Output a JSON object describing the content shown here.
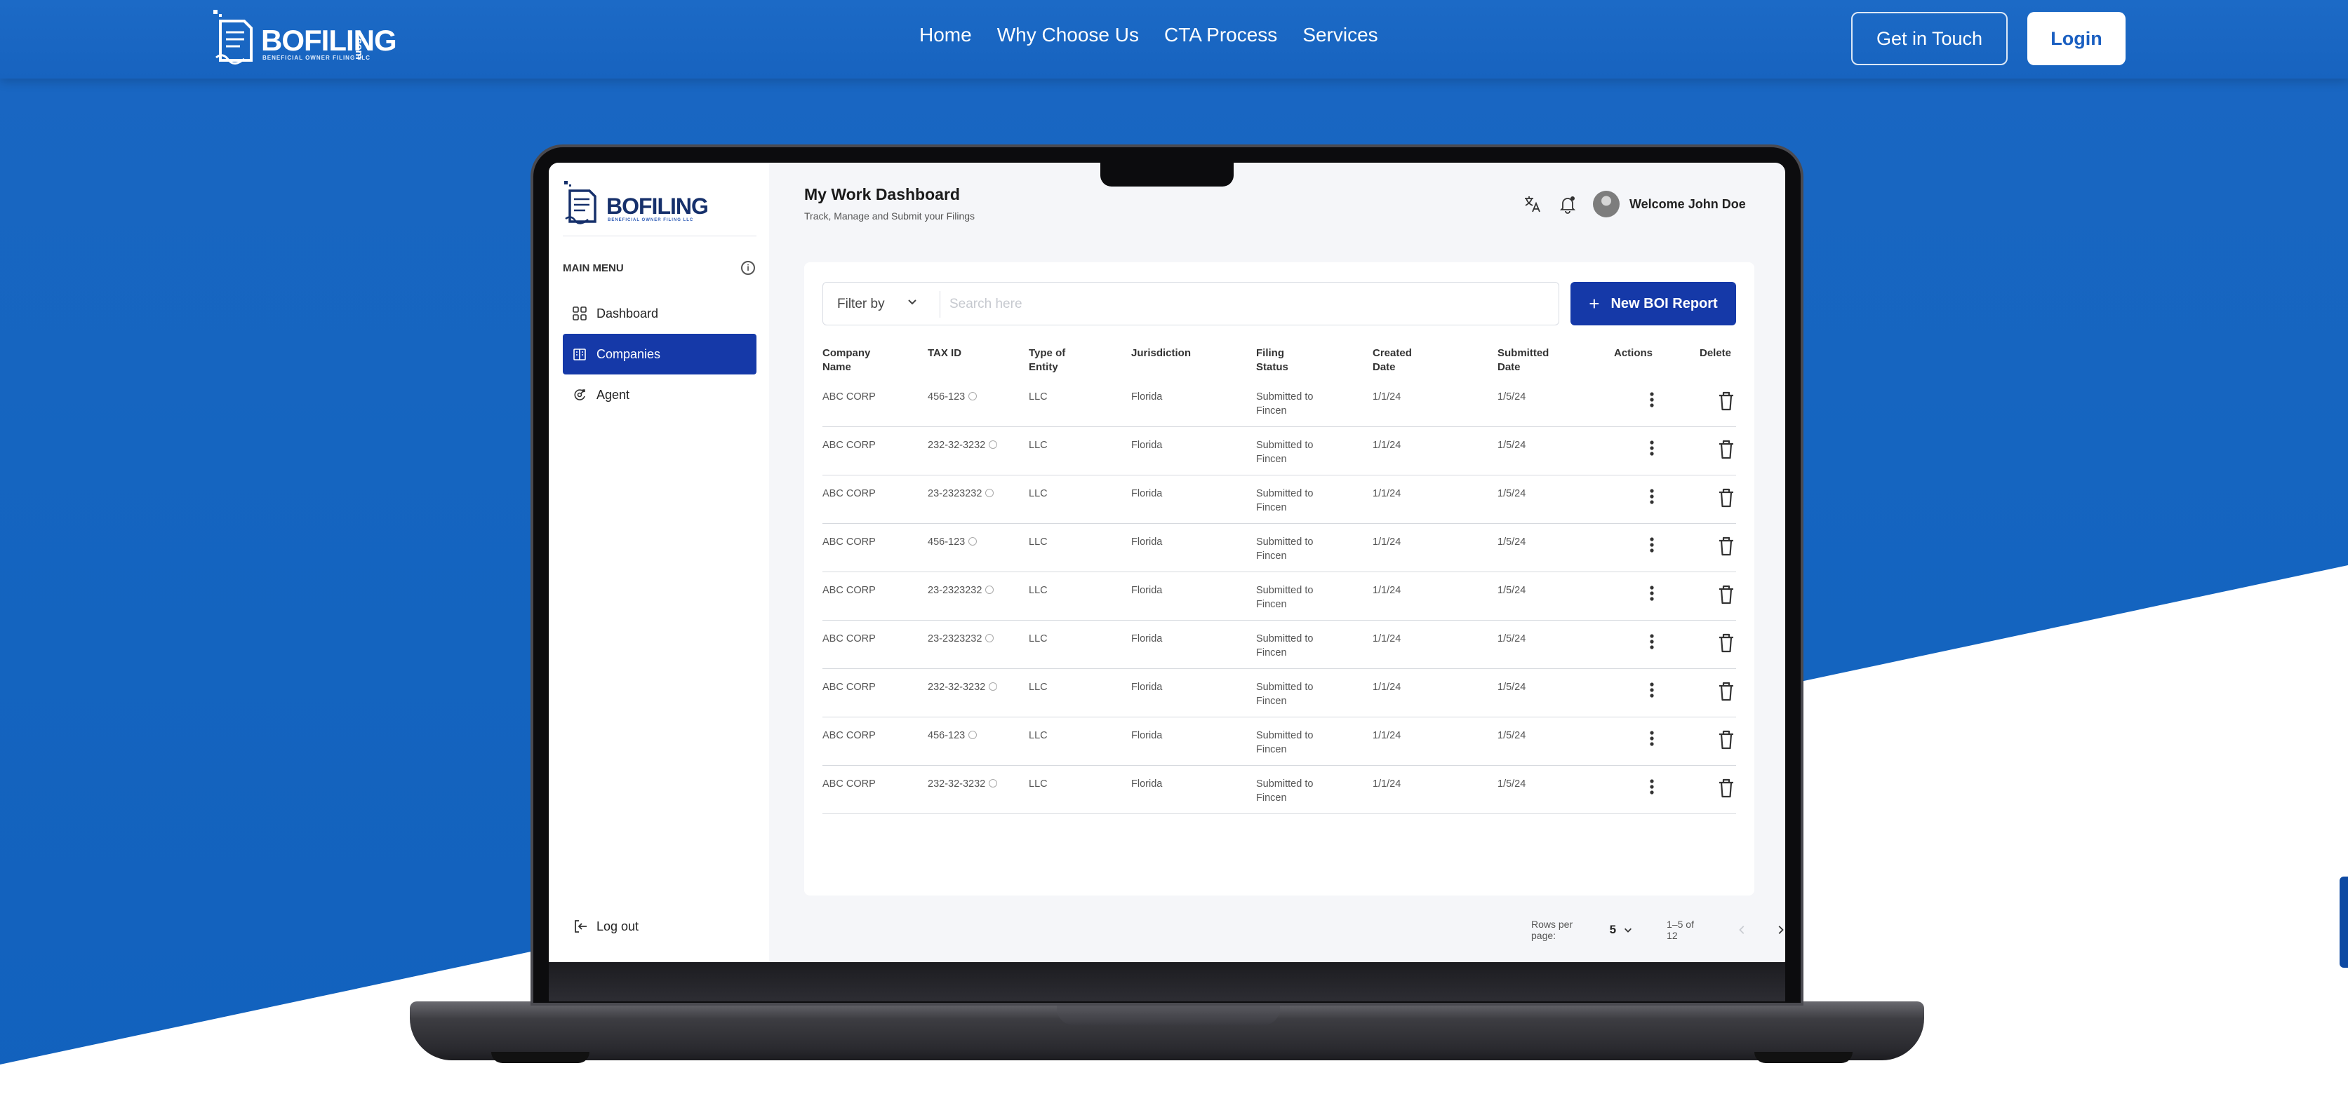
{
  "site": {
    "logo": {
      "text": "BOFILING",
      "sub": "BENEFICIAL OWNER FILING LLC",
      "com": ".com"
    },
    "nav": [
      "Home",
      "Why Choose Us",
      "CTA Process",
      "Services"
    ],
    "get_in_touch": "Get in Touch",
    "login": "Login",
    "colors": {
      "brand_blue": "#1565c0",
      "app_accent": "#1539a8"
    }
  },
  "app": {
    "logo": {
      "text": "BOFILING",
      "sub": "BENEFICIAL OWNER FILING LLC",
      "com": ".com"
    },
    "menu_title": "MAIN MENU",
    "menu": [
      {
        "label": "Dashboard",
        "icon": "grid-icon",
        "active": false
      },
      {
        "label": "Companies",
        "icon": "building-icon",
        "active": true
      },
      {
        "label": "Agent",
        "icon": "agent-icon",
        "active": false
      }
    ],
    "logout": "Log out",
    "title": "My Work Dashboard",
    "subtitle": "Track, Manage and Submit your Filings",
    "welcome": "Welcome John Doe",
    "filter_label": "Filter by",
    "search_placeholder": "Search here",
    "new_button": "New BOI Report",
    "columns": [
      "Company\nName",
      "TAX ID",
      "Type of\nEntity",
      "Jurisdiction",
      "Filing\nStatus",
      "Created\nDate",
      "Submitted\nDate",
      "Actions",
      "Delete"
    ],
    "rows": [
      {
        "company": "ABC CORP",
        "tax_id": "456-123",
        "entity": "LLC",
        "jurisdiction": "Florida",
        "status": "Submitted to Fincen",
        "created": "1/1/24",
        "submitted": "1/5/24"
      },
      {
        "company": "ABC CORP",
        "tax_id": "232-32-3232",
        "entity": "LLC",
        "jurisdiction": "Florida",
        "status": "Submitted to Fincen",
        "created": "1/1/24",
        "submitted": "1/5/24"
      },
      {
        "company": "ABC CORP",
        "tax_id": "23-2323232",
        "entity": "LLC",
        "jurisdiction": "Florida",
        "status": "Submitted to Fincen",
        "created": "1/1/24",
        "submitted": "1/5/24"
      },
      {
        "company": "ABC CORP",
        "tax_id": "456-123",
        "entity": "LLC",
        "jurisdiction": "Florida",
        "status": "Submitted to Fincen",
        "created": "1/1/24",
        "submitted": "1/5/24"
      },
      {
        "company": "ABC CORP",
        "tax_id": "23-2323232",
        "entity": "LLC",
        "jurisdiction": "Florida",
        "status": "Submitted to Fincen",
        "created": "1/1/24",
        "submitted": "1/5/24"
      },
      {
        "company": "ABC CORP",
        "tax_id": "23-2323232",
        "entity": "LLC",
        "jurisdiction": "Florida",
        "status": "Submitted to Fincen",
        "created": "1/1/24",
        "submitted": "1/5/24"
      },
      {
        "company": "ABC CORP",
        "tax_id": "232-32-3232",
        "entity": "LLC",
        "jurisdiction": "Florida",
        "status": "Submitted to Fincen",
        "created": "1/1/24",
        "submitted": "1/5/24"
      },
      {
        "company": "ABC CORP",
        "tax_id": "456-123",
        "entity": "LLC",
        "jurisdiction": "Florida",
        "status": "Submitted to Fincen",
        "created": "1/1/24",
        "submitted": "1/5/24"
      },
      {
        "company": "ABC CORP",
        "tax_id": "232-32-3232",
        "entity": "LLC",
        "jurisdiction": "Florida",
        "status": "Submitted to Fincen",
        "created": "1/1/24",
        "submitted": "1/5/24"
      }
    ],
    "pagination": {
      "rows_per_page_label": "Rows per page:",
      "rows_per_page": "5",
      "range": "1–5 of 12"
    }
  }
}
